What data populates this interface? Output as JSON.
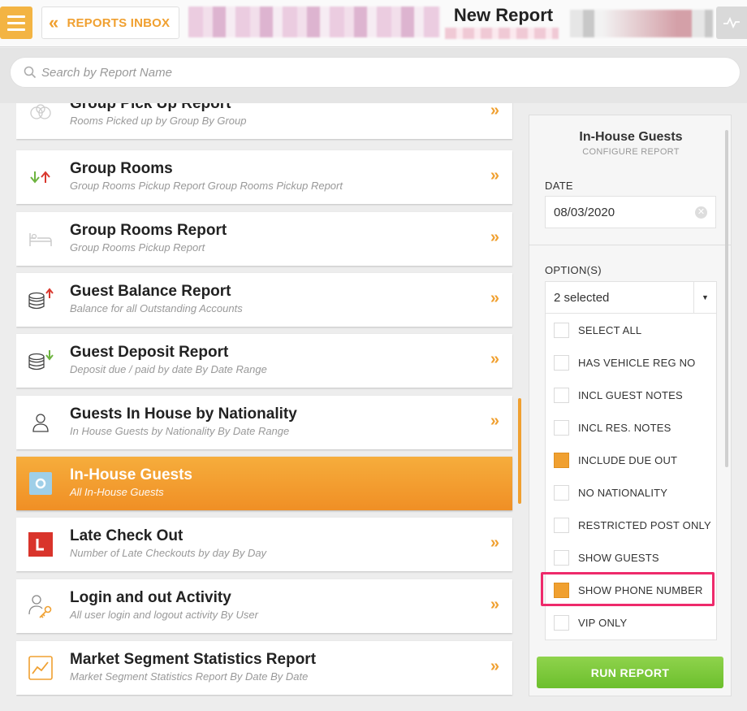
{
  "header": {
    "menu_icon": "hamburger-menu-icon",
    "back_label": "REPORTS INBOX",
    "back_icon": "double-chevron-left-icon",
    "title": "New Report",
    "activity_icon": "activity-line-icon",
    "accent_color": "#f0a030"
  },
  "search": {
    "placeholder": "Search by Report Name",
    "icon": "search-icon"
  },
  "reports": [
    {
      "title": "Group Pick Up Report",
      "subtitle": "Rooms Picked up by Group By Group",
      "icon": "group-rings-icon"
    },
    {
      "title": "Group Rooms",
      "subtitle": "Group Rooms Pickup Report Group Rooms Pickup Report",
      "icon": "up-down-arrows-icon"
    },
    {
      "title": "Group Rooms Report",
      "subtitle": "Group Rooms Pickup Report",
      "icon": "bed-icon"
    },
    {
      "title": "Guest Balance Report",
      "subtitle": "Balance for all Outstanding Accounts",
      "icon": "coins-up-icon"
    },
    {
      "title": "Guest Deposit Report",
      "subtitle": "Deposit due / paid by date By Date Range",
      "icon": "coins-down-icon"
    },
    {
      "title": "Guests In House by Nationality",
      "subtitle": "In House Guests by Nationality By Date Range",
      "icon": "person-icon"
    },
    {
      "title": "In-House Guests",
      "subtitle": "All In-House Guests",
      "icon": "circle-badge-icon",
      "active": true
    },
    {
      "title": "Late Check Out",
      "subtitle": "Number of Late Checkouts by day By Day",
      "icon": "late-l-icon"
    },
    {
      "title": "Login and out Activity",
      "subtitle": "All user login and logout activity By User",
      "icon": "user-key-icon"
    },
    {
      "title": "Market Segment Statistics Report",
      "subtitle": "Market Segment Statistics Report By Date By Date",
      "icon": "line-chart-icon"
    }
  ],
  "arrow_glyph": "»",
  "config": {
    "title": "In-House Guests",
    "subtitle": "CONFIGURE REPORT",
    "date_label": "DATE",
    "date_value": "08/03/2020",
    "options_label": "OPTION(S)",
    "selected_text": "2 selected",
    "options": [
      {
        "label": "SELECT ALL",
        "checked": false
      },
      {
        "label": "HAS VEHICLE REG NO",
        "checked": false
      },
      {
        "label": "INCL GUEST NOTES",
        "checked": false
      },
      {
        "label": "INCL RES. NOTES",
        "checked": false
      },
      {
        "label": "INCLUDE DUE OUT",
        "checked": true
      },
      {
        "label": "NO NATIONALITY",
        "checked": false
      },
      {
        "label": "RESTRICTED POST ONLY",
        "checked": false
      },
      {
        "label": "SHOW GUESTS",
        "checked": false
      },
      {
        "label": "SHOW PHONE NUMBER",
        "checked": true
      },
      {
        "label": "VIP ONLY",
        "checked": false
      }
    ],
    "run_label": "RUN REPORT",
    "run_color": "#7ac83a",
    "highlight_color": "#ee2a6b"
  }
}
